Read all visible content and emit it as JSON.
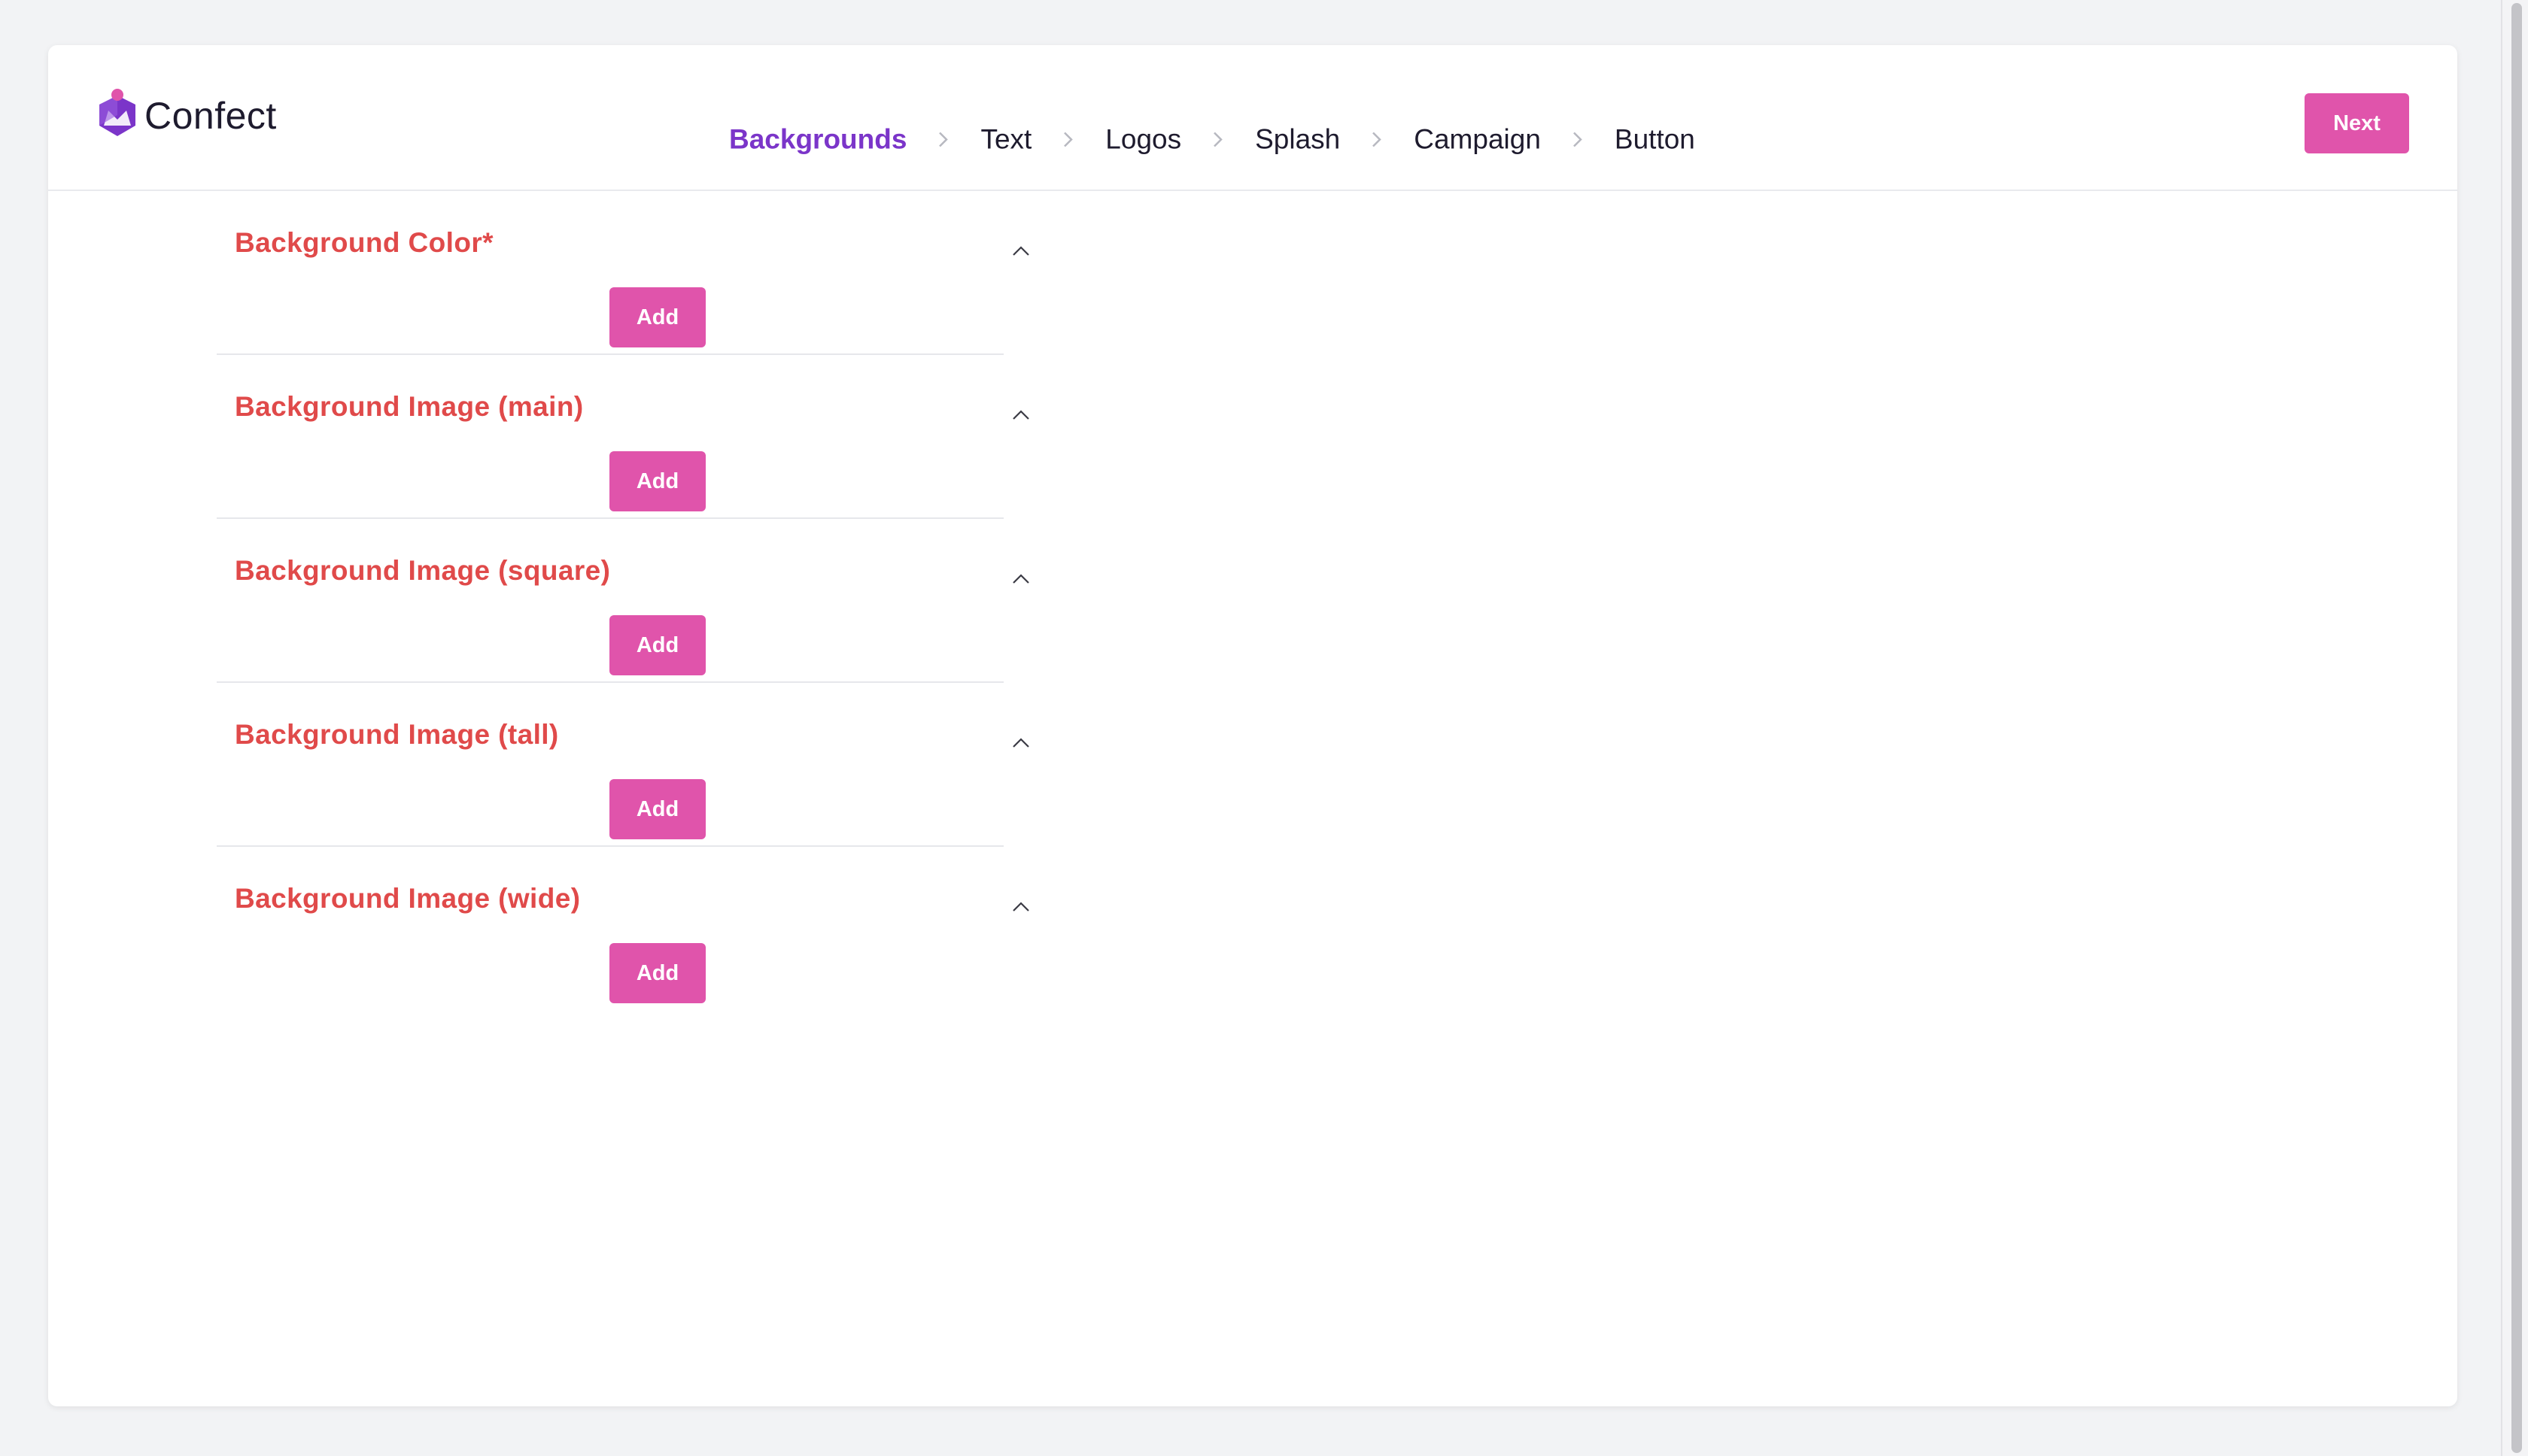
{
  "app": {
    "name": "Confect",
    "brand_color": "#7b35c9",
    "accent_color": "#e054ab",
    "section_title_color": "#e04a4a"
  },
  "header": {
    "steps": [
      {
        "label": "Backgrounds",
        "active": true
      },
      {
        "label": "Text",
        "active": false
      },
      {
        "label": "Logos",
        "active": false
      },
      {
        "label": "Splash",
        "active": false
      },
      {
        "label": "Campaign",
        "active": false
      },
      {
        "label": "Button",
        "active": false
      }
    ],
    "next_label": "Next"
  },
  "sections": [
    {
      "title": "Background Color*",
      "add_label": "Add",
      "expanded": true
    },
    {
      "title": "Background Image (main)",
      "add_label": "Add",
      "expanded": true
    },
    {
      "title": "Background Image (square)",
      "add_label": "Add",
      "expanded": true
    },
    {
      "title": "Background Image (tall)",
      "add_label": "Add",
      "expanded": true
    },
    {
      "title": "Background Image (wide)",
      "add_label": "Add",
      "expanded": true
    }
  ],
  "icons": {
    "logo": "confect-logo-icon",
    "step_separator": "chevron-right-icon",
    "collapse": "chevron-up-icon"
  }
}
